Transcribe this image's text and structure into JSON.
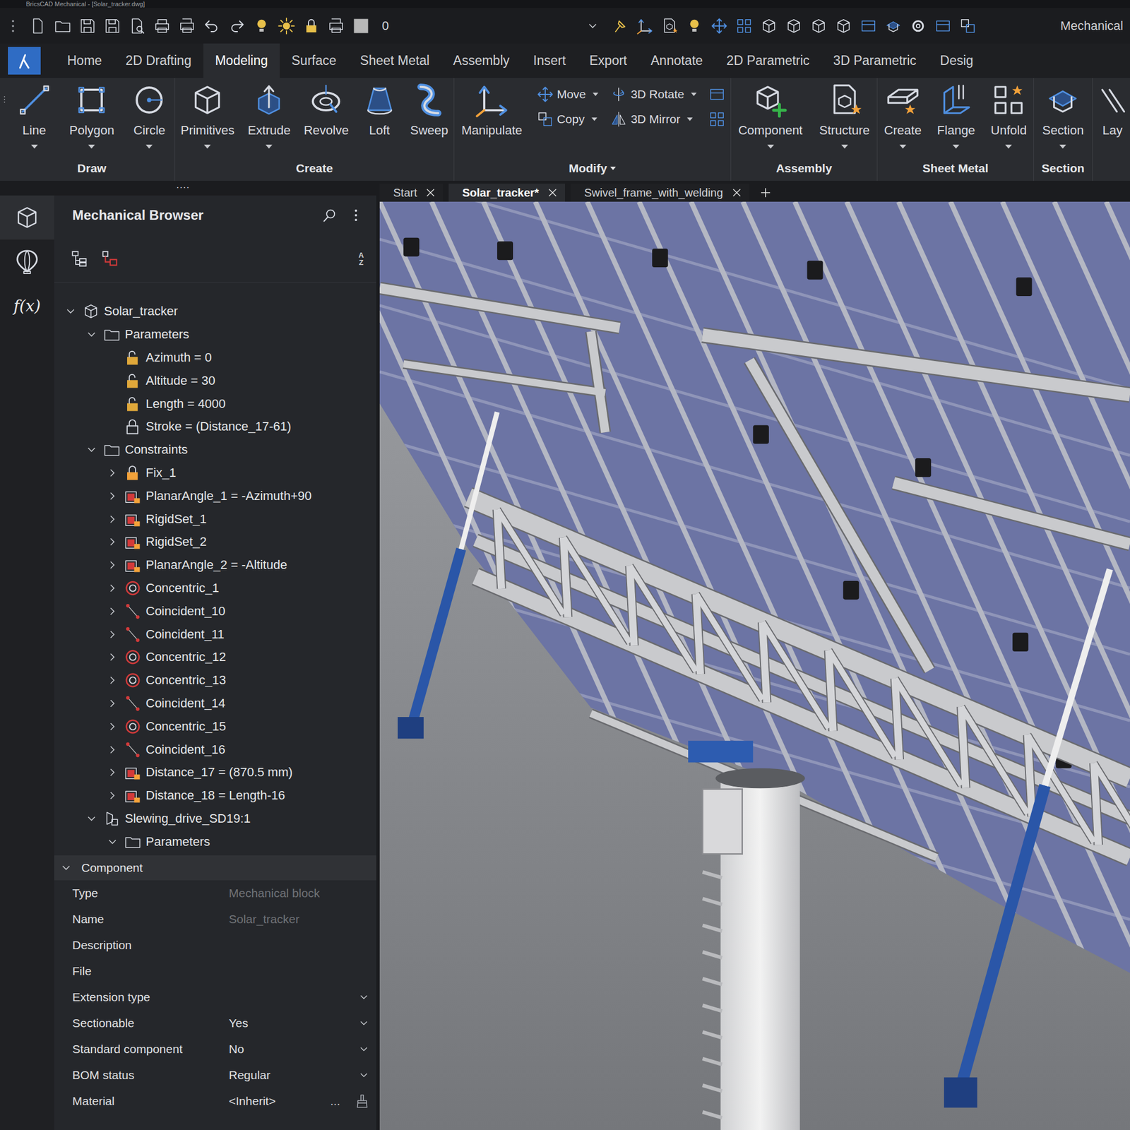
{
  "window": {
    "title": "BricsCAD Mechanical - [Solar_tracker.dwg]"
  },
  "quick_access": {
    "layer": "0",
    "workspace": "Mechanical"
  },
  "ribbon": {
    "tabs": [
      {
        "label": "Home",
        "selected": false
      },
      {
        "label": "2D Drafting",
        "selected": false
      },
      {
        "label": "Modeling",
        "selected": true
      },
      {
        "label": "Surface",
        "selected": false
      },
      {
        "label": "Sheet Metal",
        "selected": false
      },
      {
        "label": "Assembly",
        "selected": false
      },
      {
        "label": "Insert",
        "selected": false
      },
      {
        "label": "Export",
        "selected": false
      },
      {
        "label": "Annotate",
        "selected": false
      },
      {
        "label": "2D Parametric",
        "selected": false
      },
      {
        "label": "3D Parametric",
        "selected": false
      },
      {
        "label": "Desig",
        "selected": false
      }
    ],
    "groups": [
      {
        "label": "Draw",
        "dropdown": false,
        "buttons": [
          {
            "label": "Line",
            "kind": "large",
            "dropdown": true
          },
          {
            "label": "Polygon",
            "kind": "large",
            "dropdown": true
          },
          {
            "label": "Circle",
            "kind": "large",
            "dropdown": true
          }
        ]
      },
      {
        "label": "Create",
        "dropdown": false,
        "buttons": [
          {
            "label": "Primitives",
            "kind": "large",
            "dropdown": true
          },
          {
            "label": "Extrude",
            "kind": "large",
            "dropdown": true
          },
          {
            "label": "Revolve",
            "kind": "large",
            "dropdown": false
          },
          {
            "label": "Loft",
            "kind": "large",
            "dropdown": false
          },
          {
            "label": "Sweep",
            "kind": "large",
            "dropdown": false
          }
        ]
      },
      {
        "label": "Modify",
        "dropdown": true,
        "buttons": [
          {
            "label": "Manipulate",
            "kind": "large",
            "dropdown": false
          },
          {
            "label": "Move",
            "kind": "small",
            "dropdown": true
          },
          {
            "label": "Copy",
            "kind": "small",
            "dropdown": true
          },
          {
            "label": "3D Rotate",
            "kind": "small",
            "dropdown": true
          },
          {
            "label": "3D Mirror",
            "kind": "small",
            "dropdown": true
          },
          {
            "label": "",
            "kind": "icon",
            "dropdown": false
          },
          {
            "label": "",
            "kind": "icon",
            "dropdown": false
          }
        ]
      },
      {
        "label": "Assembly",
        "dropdown": false,
        "buttons": [
          {
            "label": "Component",
            "kind": "large",
            "dropdown": true
          },
          {
            "label": "Structure",
            "kind": "large",
            "dropdown": true
          }
        ]
      },
      {
        "label": "Sheet Metal",
        "dropdown": false,
        "buttons": [
          {
            "label": "Create",
            "kind": "large",
            "dropdown": true
          },
          {
            "label": "Flange",
            "kind": "large",
            "dropdown": true
          },
          {
            "label": "Unfold",
            "kind": "large",
            "dropdown": true
          }
        ]
      },
      {
        "label": "Section",
        "dropdown": false,
        "buttons": [
          {
            "label": "Section",
            "kind": "large",
            "dropdown": true
          }
        ]
      },
      {
        "label": "",
        "dropdown": false,
        "buttons": [
          {
            "label": "Lay",
            "kind": "large",
            "dropdown": false
          }
        ]
      }
    ],
    "more": "...."
  },
  "documents": {
    "tabs": [
      {
        "label": "Start",
        "selected": false
      },
      {
        "label": "Solar_tracker*",
        "selected": true
      },
      {
        "label": "Swivel_frame_with_welding",
        "selected": false
      }
    ]
  },
  "sidebar": {
    "items": [
      {
        "kind": "icon",
        "text": "",
        "selected": true
      },
      {
        "kind": "icon",
        "text": "",
        "selected": false
      },
      {
        "kind": "text",
        "text": "f(x)",
        "selected": false
      }
    ]
  },
  "browser": {
    "title": "Mechanical Browser",
    "sort_icon": [
      "A",
      "Z"
    ],
    "tree": [
      {
        "label": "Solar_tracker",
        "level": 0,
        "kind": "component",
        "expandable": true,
        "expanded": true
      },
      {
        "label": "Parameters",
        "level": 1,
        "kind": "folder",
        "expandable": true,
        "expanded": true
      },
      {
        "label": "Azimuth = 0",
        "level": 2,
        "kind": "parameter",
        "expandable": false,
        "expanded": false
      },
      {
        "label": "Altitude = 30",
        "level": 2,
        "kind": "parameter",
        "expandable": false,
        "expanded": false
      },
      {
        "label": "Length = 4000",
        "level": 2,
        "kind": "parameter",
        "expandable": false,
        "expanded": false
      },
      {
        "label": "Stroke = (Distance_17-61)",
        "level": 2,
        "kind": "expression",
        "expandable": false,
        "expanded": false
      },
      {
        "label": "Constraints",
        "level": 1,
        "kind": "folder",
        "expandable": true,
        "expanded": true
      },
      {
        "label": "Fix_1",
        "level": 2,
        "kind": "fix",
        "expandable": true,
        "expanded": false
      },
      {
        "label": "PlanarAngle_1 = -Azimuth+90",
        "level": 2,
        "kind": "angle",
        "expandable": true,
        "expanded": false
      },
      {
        "label": "RigidSet_1",
        "level": 2,
        "kind": "angle",
        "expandable": true,
        "expanded": false
      },
      {
        "label": "RigidSet_2",
        "level": 2,
        "kind": "angle",
        "expandable": true,
        "expanded": false
      },
      {
        "label": "PlanarAngle_2 = -Altitude",
        "level": 2,
        "kind": "angle",
        "expandable": true,
        "expanded": false
      },
      {
        "label": "Concentric_1",
        "level": 2,
        "kind": "concentric",
        "expandable": true,
        "expanded": false
      },
      {
        "label": "Coincident_10",
        "level": 2,
        "kind": "coincident",
        "expandable": true,
        "expanded": false
      },
      {
        "label": "Coincident_11",
        "level": 2,
        "kind": "coincident",
        "expandable": true,
        "expanded": false
      },
      {
        "label": "Concentric_12",
        "level": 2,
        "kind": "concentric",
        "expandable": true,
        "expanded": false
      },
      {
        "label": "Concentric_13",
        "level": 2,
        "kind": "concentric",
        "expandable": true,
        "expanded": false
      },
      {
        "label": "Coincident_14",
        "level": 2,
        "kind": "coincident",
        "expandable": true,
        "expanded": false
      },
      {
        "label": "Concentric_15",
        "level": 2,
        "kind": "concentric",
        "expandable": true,
        "expanded": false
      },
      {
        "label": "Coincident_16",
        "level": 2,
        "kind": "coincident",
        "expandable": true,
        "expanded": false
      },
      {
        "label": "Distance_17 = (870.5 mm)",
        "level": 2,
        "kind": "angle",
        "expandable": true,
        "expanded": false
      },
      {
        "label": "Distance_18 = Length-16",
        "level": 2,
        "kind": "angle",
        "expandable": true,
        "expanded": false
      },
      {
        "label": "Slewing_drive_SD19:1",
        "level": 1,
        "kind": "subassembly",
        "expandable": true,
        "expanded": true
      },
      {
        "label": "Parameters",
        "level": 2,
        "kind": "folder",
        "expandable": true,
        "expanded": true
      }
    ],
    "properties": {
      "section": "Component",
      "expanded": true,
      "browse": "...",
      "rows": [
        {
          "label": "Type",
          "value": "Mechanical block",
          "kind": "text",
          "disabled": true
        },
        {
          "label": "Name",
          "value": "Solar_tracker",
          "kind": "text",
          "disabled": true
        },
        {
          "label": "Description",
          "value": "",
          "kind": "text",
          "disabled": false
        },
        {
          "label": "File",
          "value": "",
          "kind": "text",
          "disabled": false
        },
        {
          "label": "Extension type",
          "value": "",
          "kind": "select",
          "disabled": false
        },
        {
          "label": "Sectionable",
          "value": "Yes",
          "kind": "select",
          "disabled": false
        },
        {
          "label": "Standard component",
          "value": "No",
          "kind": "select",
          "disabled": false
        },
        {
          "label": "BOM status",
          "value": "Regular",
          "kind": "select",
          "disabled": false
        },
        {
          "label": "Material",
          "value": "<Inherit>",
          "kind": "browse",
          "disabled": false
        }
      ]
    }
  }
}
